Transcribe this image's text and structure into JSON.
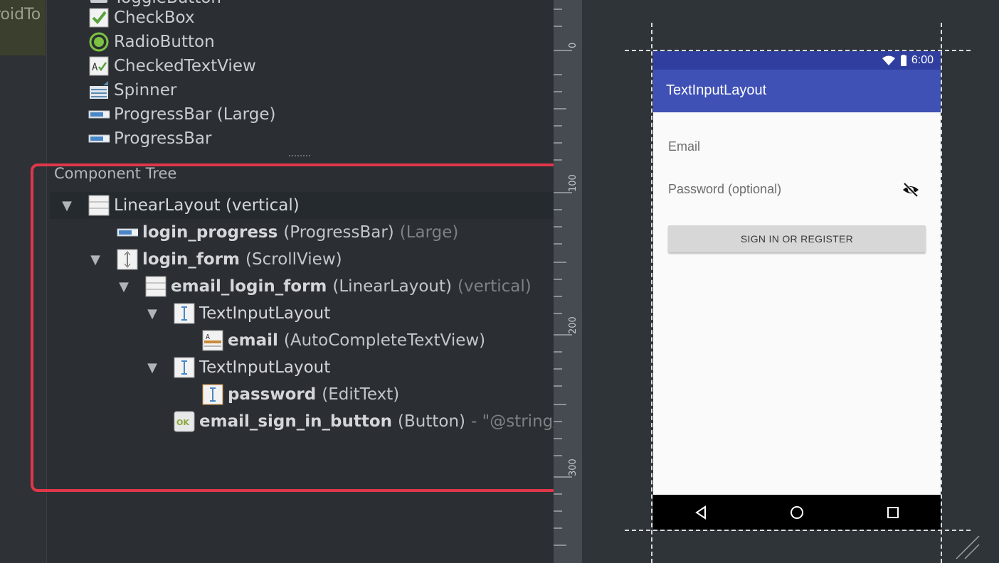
{
  "left_tab": {
    "label": "roidTo",
    "sub": ")"
  },
  "palette": {
    "items": [
      {
        "label": "ToggleButton",
        "icon": "toggle-icon"
      },
      {
        "label": "CheckBox",
        "icon": "checkbox-icon"
      },
      {
        "label": "RadioButton",
        "icon": "radio-icon"
      },
      {
        "label": "CheckedTextView",
        "icon": "checked-textview-icon"
      },
      {
        "label": "Spinner",
        "icon": "spinner-icon"
      },
      {
        "label": "ProgressBar (Large)",
        "icon": "progressbar-icon"
      },
      {
        "label": "ProgressBar",
        "icon": "progressbar-icon"
      }
    ]
  },
  "component_tree": {
    "title": "Component Tree",
    "rows": [
      {
        "name": "LinearLayout (vertical)",
        "type": "",
        "extra": "",
        "icon": "linearlayout-icon",
        "expanded": true
      },
      {
        "name": "login_progress",
        "type": "(ProgressBar)",
        "extra": "(Large)",
        "icon": "progressbar-icon"
      },
      {
        "name": "login_form",
        "type": "(ScrollView)",
        "extra": "",
        "icon": "scrollview-icon",
        "expanded": true
      },
      {
        "name": "email_login_form",
        "type": "(LinearLayout)",
        "extra": "(vertical)",
        "icon": "linearlayout-icon",
        "expanded": true
      },
      {
        "name": "TextInputLayout",
        "type": "",
        "extra": "",
        "icon": "textinput-icon",
        "expanded": true
      },
      {
        "name": "email",
        "type": "(AutoCompleteTextView)",
        "extra": "",
        "icon": "autocomplete-icon"
      },
      {
        "name": "TextInputLayout",
        "type": "",
        "extra": "",
        "icon": "textinput-icon",
        "expanded": true
      },
      {
        "name": "password",
        "type": "(EditText)",
        "extra": "",
        "icon": "edittext-icon"
      },
      {
        "name": "email_sign_in_button",
        "type": "(Button)",
        "extra": "- \"@string/",
        "icon": "button-icon"
      }
    ]
  },
  "ruler": {
    "labels": [
      "0",
      "100",
      "200",
      "300"
    ]
  },
  "phone": {
    "status_time": "6:00",
    "app_title": "TextInputLayout",
    "email_hint": "Email",
    "password_hint": "Password (optional)",
    "sign_in_label": "SIGN IN OR REGISTER",
    "colors": {
      "status_bar": "#303f9f",
      "app_bar": "#3f51b5"
    }
  },
  "highlight_color": "#e0374a"
}
